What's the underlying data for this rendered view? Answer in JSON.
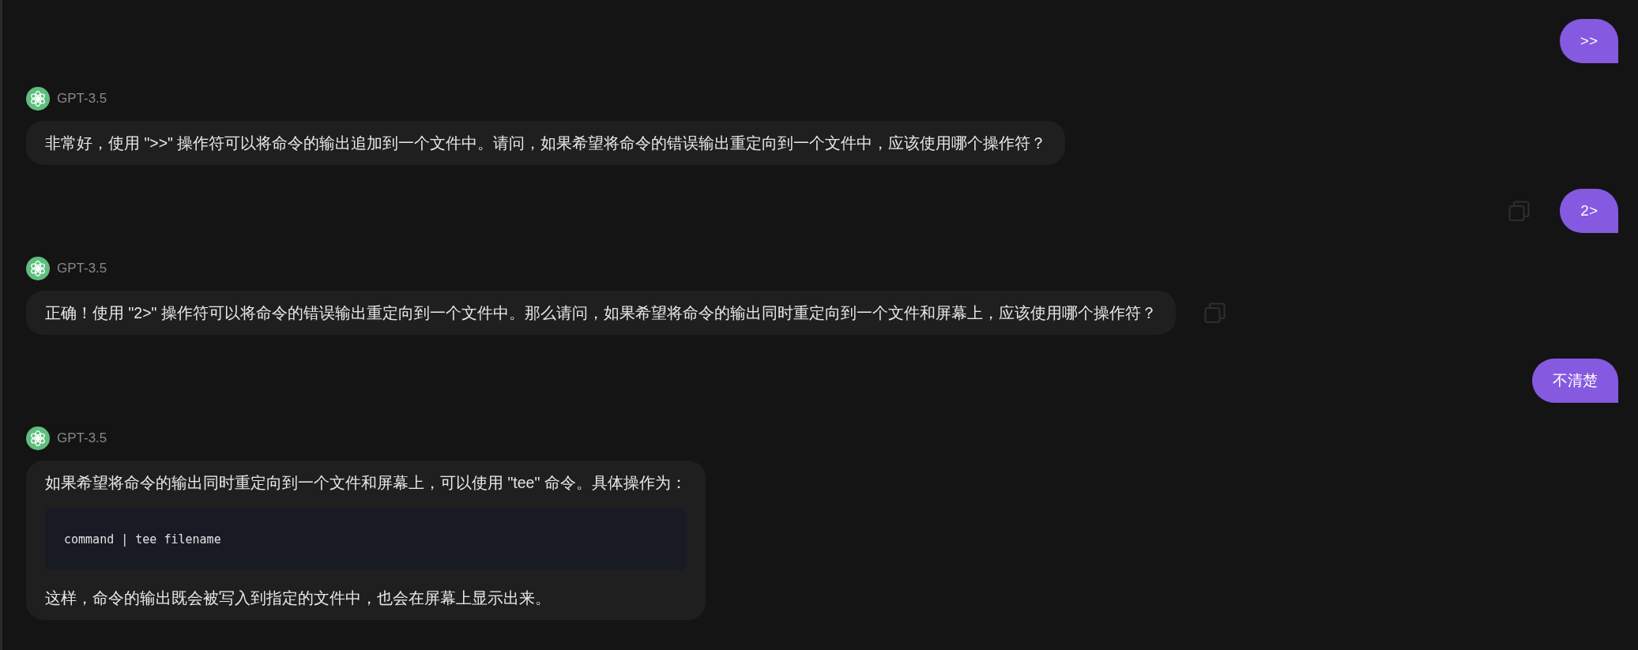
{
  "messages": [
    {
      "kind": "user",
      "text": ">>",
      "copy_icon": false
    },
    {
      "kind": "assistant",
      "sender": "GPT-3.5",
      "copy_icon": false,
      "blocks": [
        {
          "kind": "paragraph",
          "text": "非常好，使用 \">>\" 操作符可以将命令的输出追加到一个文件中。请问，如果希望将命令的错误输出重定向到一个文件中，应该使用哪个操作符？"
        }
      ]
    },
    {
      "kind": "user",
      "text": "2>",
      "copy_icon": true
    },
    {
      "kind": "assistant",
      "sender": "GPT-3.5",
      "copy_icon": true,
      "blocks": [
        {
          "kind": "paragraph",
          "text": "正确！使用 \"2>\" 操作符可以将命令的错误输出重定向到一个文件中。那么请问，如果希望将命令的输出同时重定向到一个文件和屏幕上，应该使用哪个操作符？"
        }
      ]
    },
    {
      "kind": "user",
      "text": "不清楚",
      "copy_icon": false
    },
    {
      "kind": "assistant",
      "sender": "GPT-3.5",
      "copy_icon": false,
      "blocks": [
        {
          "kind": "paragraph",
          "text": "如果希望将命令的输出同时重定向到一个文件和屏幕上，可以使用 \"tee\" 命令。具体操作为："
        },
        {
          "kind": "code",
          "text": "command | tee filename"
        },
        {
          "kind": "paragraph",
          "text": "这样，命令的输出既会被写入到指定的文件中，也会在屏幕上显示出来。"
        }
      ]
    }
  ]
}
